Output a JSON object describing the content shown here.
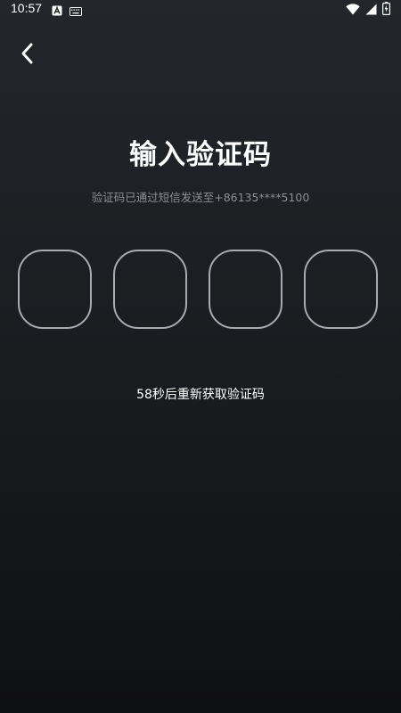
{
  "status_bar": {
    "time": "10:57"
  },
  "icons": {
    "back": "chevron-left-icon",
    "status_a": "a-notification-icon",
    "status_keyboard": "keyboard-icon",
    "status_wifi": "wifi-icon",
    "status_signal": "signal-icon",
    "status_battery": "battery-icon"
  },
  "page": {
    "title": "输入验证码",
    "subtitle": "验证码已通过短信发送至+86135****5100",
    "resend": "58秒后重新获取验证码"
  },
  "code_input": {
    "digits": [
      "",
      "",
      "",
      ""
    ]
  },
  "colors": {
    "background_top": "#23262b",
    "background_bottom": "#0f1013",
    "box_border": "#a8abb0",
    "subtitle": "#8b8e93",
    "text": "#ffffff"
  }
}
